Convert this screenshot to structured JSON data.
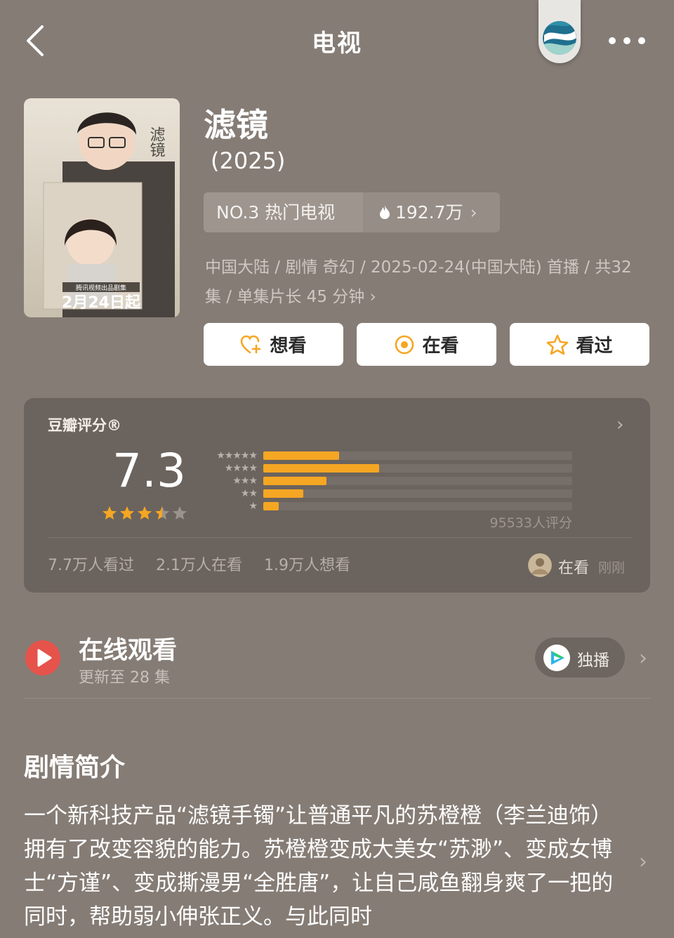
{
  "header": {
    "title": "电视"
  },
  "show": {
    "title": "滤镜",
    "year": "(2025)",
    "rank_label": "NO.3 热门电视",
    "heat": "192.7万",
    "meta": "中国大陆 / 剧情 奇幻 / 2025-02-24(中国大陆) 首播 / 共32集 / 单集片长 45 分钟",
    "poster_text": "2月24日起",
    "poster_subtext": "腾讯视频出品剧集",
    "poster_title_art": "滤镜"
  },
  "actions": {
    "want": "想看",
    "watching": "在看",
    "watched": "看过"
  },
  "rating": {
    "title": "豆瓣评分®",
    "score": "7.3",
    "star_value": 3.5,
    "distribution": [
      {
        "stars": "★★★★★",
        "fraction": 0.245
      },
      {
        "stars": "★★★★",
        "fraction": 0.375
      },
      {
        "stars": "★★★",
        "fraction": 0.205
      },
      {
        "stars": "★★",
        "fraction": 0.13
      },
      {
        "stars": "★",
        "fraction": 0.05
      }
    ],
    "raters": "95533人评分",
    "stats": [
      "7.7万人看过",
      "2.1万人在看",
      "1.9万人想看"
    ],
    "friend_status": "在看",
    "friend_time": "刚刚"
  },
  "watch": {
    "title": "在线观看",
    "subtitle": "更新至 28 集",
    "exclusive": "独播"
  },
  "synopsis": {
    "title": "剧情简介",
    "body": "一个新科技产品“滤镜手镯”让普通平凡的苏橙橙（李兰迪饰）拥有了改变容貌的能力。苏橙橙变成大美女“苏渺”、变成女博士“方谨”、变成撕漫男“全胜唐”，让自己咸鱼翻身爽了一把的同时，帮助弱小伸张正义。与此同时"
  },
  "colors": {
    "background": "#857c75",
    "card": "#6b635d",
    "accent_orange": "#f5a623",
    "play_red": "#e5534b"
  }
}
